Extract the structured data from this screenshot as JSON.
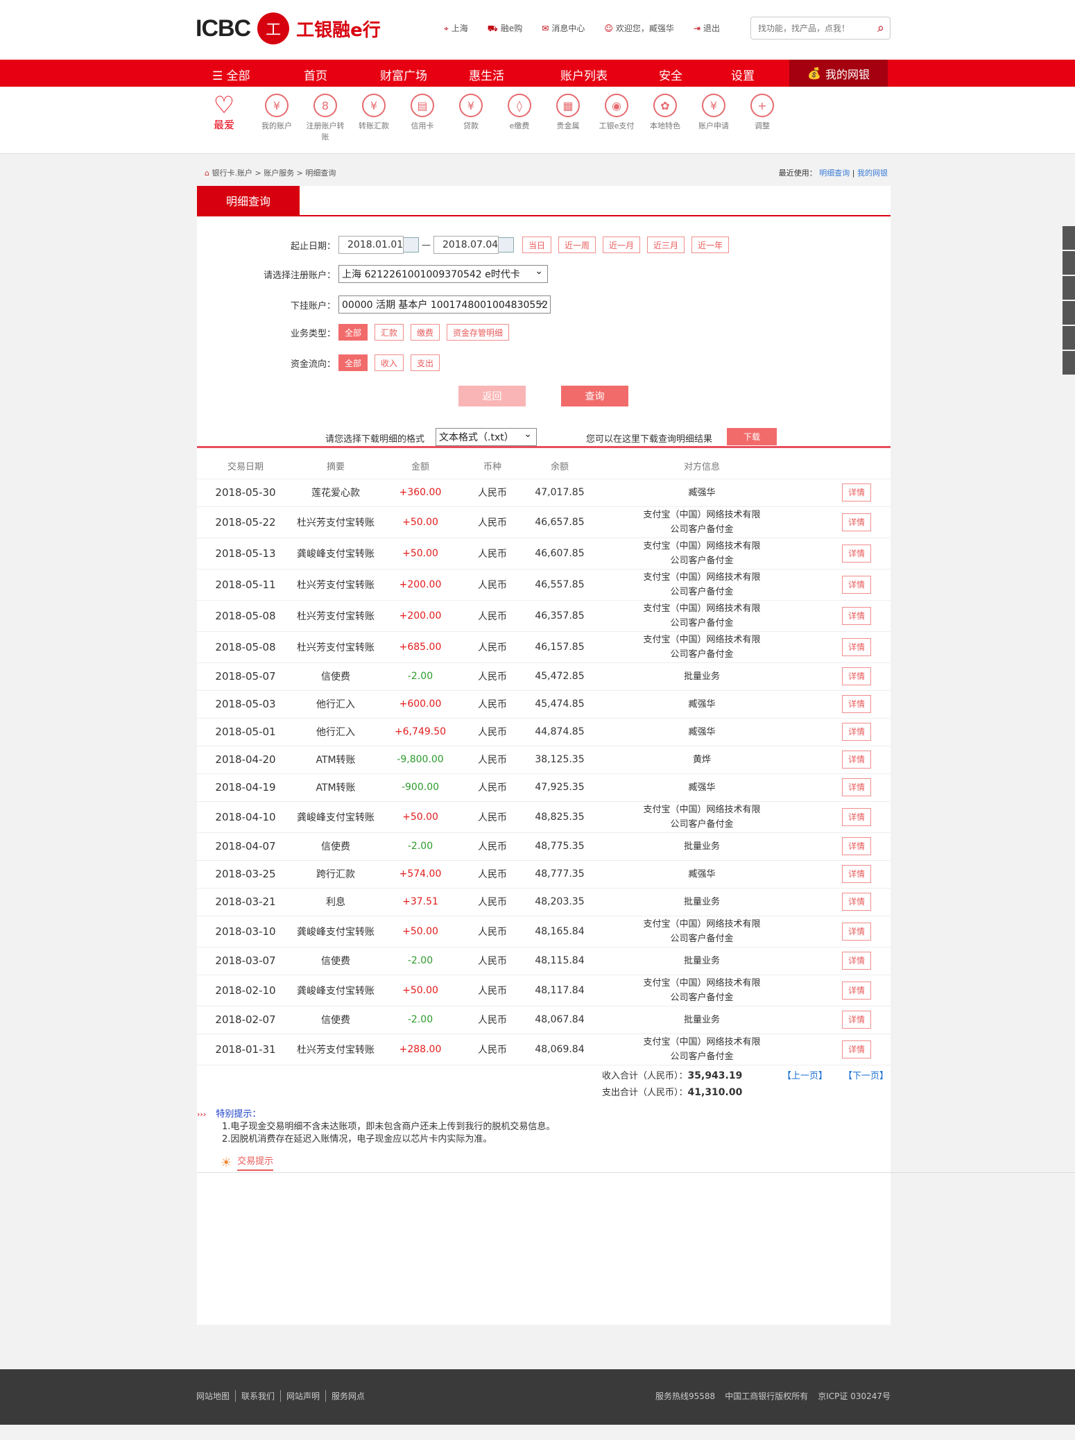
{
  "brand": {
    "icbc": "ICBC",
    "seal": "工",
    "name": "工银融e行"
  },
  "top_links": [
    {
      "icon": "location-icon",
      "glyph": "⌖",
      "label": "上海"
    },
    {
      "icon": "cart-icon",
      "glyph": "⛟",
      "label": "融e购"
    },
    {
      "icon": "mail-icon",
      "glyph": "✉",
      "label": "消息中心"
    },
    {
      "icon": "user-icon",
      "glyph": "☺",
      "label": "欢迎您，臧强华"
    },
    {
      "icon": "logout-icon",
      "glyph": "⇥",
      "label": "退出"
    }
  ],
  "search": {
    "placeholder": "找功能，找产品，点我！"
  },
  "nav": {
    "items": [
      "☰ 全部",
      "首页",
      "财富广场",
      "惠生活",
      "账户列表",
      "安全",
      "设置"
    ],
    "my_bank": "我的网银"
  },
  "quick": {
    "favorite": "最爱",
    "items": [
      {
        "label": "我的账户",
        "glyph": "¥",
        "icon": "account-icon"
      },
      {
        "label": "注册账户转账",
        "glyph": "8",
        "icon": "transfer-register-icon"
      },
      {
        "label": "转账汇款",
        "glyph": "¥",
        "icon": "remit-icon"
      },
      {
        "label": "信用卡",
        "glyph": "▤",
        "icon": "credit-card-icon"
      },
      {
        "label": "贷款",
        "glyph": "¥",
        "icon": "loan-icon"
      },
      {
        "label": "e缴费",
        "glyph": "◊",
        "icon": "payment-icon"
      },
      {
        "label": "贵金属",
        "glyph": "▦",
        "icon": "gold-icon"
      },
      {
        "label": "工银e支付",
        "glyph": "◉",
        "icon": "epay-icon"
      },
      {
        "label": "本地特色",
        "glyph": "✿",
        "icon": "local-icon"
      },
      {
        "label": "账户申请",
        "glyph": "¥",
        "icon": "apply-icon"
      },
      {
        "label": "调整",
        "glyph": "+",
        "icon": "adjust-icon"
      }
    ]
  },
  "breadcrumb": {
    "path": "银行卡.账户 > 账户服务 > 明细查询"
  },
  "recent": {
    "label": "最近使用：",
    "a": "明细查询",
    "sep": "|",
    "b": "我的网银"
  },
  "tab": "明细查询",
  "form": {
    "date_label": "起止日期：",
    "start": "2018.01.01",
    "dash": "—",
    "end": "2018.07.04",
    "periods": [
      "当日",
      "近一周",
      "近一月",
      "近三月",
      "近一年"
    ],
    "account_label": "请选择注册账户：",
    "account_value": "上海 6212261001009370542 e时代卡",
    "sub_label": "下挂账户：",
    "sub_value": "00000 活期 基本户 1001748001004830552",
    "type_label": "业务类型：",
    "types": [
      "全部",
      "汇款",
      "缴费",
      "资金存管明细"
    ],
    "flow_label": "资金流向：",
    "flows": [
      "全部",
      "收入",
      "支出"
    ],
    "back": "返回",
    "query": "查询",
    "download_label": "请您选择下载明细的格式",
    "download_format": "文本格式（.txt）",
    "download_hint": "您可以在这里下载查询明细结果",
    "download_btn": "下载"
  },
  "table": {
    "headers": [
      "交易日期",
      "摘要",
      "金额",
      "币种",
      "余额",
      "对方信息",
      ""
    ],
    "detail_label": "详情",
    "rows": [
      {
        "date": "2018-05-30",
        "summary": "莲花爱心款",
        "amount": "+360.00",
        "sign": "pos",
        "cur": "人民币",
        "balance": "47,017.85",
        "cp": "臧强华"
      },
      {
        "date": "2018-05-22",
        "summary": "杜兴芳支付宝转账",
        "amount": "+50.00",
        "sign": "pos",
        "cur": "人民币",
        "balance": "46,657.85",
        "cp": "支付宝（中国）网络技术有限公司客户备付金"
      },
      {
        "date": "2018-05-13",
        "summary": "龚峻峰支付宝转账",
        "amount": "+50.00",
        "sign": "pos",
        "cur": "人民币",
        "balance": "46,607.85",
        "cp": "支付宝（中国）网络技术有限公司客户备付金"
      },
      {
        "date": "2018-05-11",
        "summary": "杜兴芳支付宝转账",
        "amount": "+200.00",
        "sign": "pos",
        "cur": "人民币",
        "balance": "46,557.85",
        "cp": "支付宝（中国）网络技术有限公司客户备付金"
      },
      {
        "date": "2018-05-08",
        "summary": "杜兴芳支付宝转账",
        "amount": "+200.00",
        "sign": "pos",
        "cur": "人民币",
        "balance": "46,357.85",
        "cp": "支付宝（中国）网络技术有限公司客户备付金"
      },
      {
        "date": "2018-05-08",
        "summary": "杜兴芳支付宝转账",
        "amount": "+685.00",
        "sign": "pos",
        "cur": "人民币",
        "balance": "46,157.85",
        "cp": "支付宝（中国）网络技术有限公司客户备付金"
      },
      {
        "date": "2018-05-07",
        "summary": "信使费",
        "amount": "-2.00",
        "sign": "neg",
        "cur": "人民币",
        "balance": "45,472.85",
        "cp": "批量业务"
      },
      {
        "date": "2018-05-03",
        "summary": "他行汇入",
        "amount": "+600.00",
        "sign": "pos",
        "cur": "人民币",
        "balance": "45,474.85",
        "cp": "臧强华"
      },
      {
        "date": "2018-05-01",
        "summary": "他行汇入",
        "amount": "+6,749.50",
        "sign": "pos",
        "cur": "人民币",
        "balance": "44,874.85",
        "cp": "臧强华"
      },
      {
        "date": "2018-04-20",
        "summary": "ATM转账",
        "amount": "-9,800.00",
        "sign": "neg",
        "cur": "人民币",
        "balance": "38,125.35",
        "cp": "黄烨"
      },
      {
        "date": "2018-04-19",
        "summary": "ATM转账",
        "amount": "-900.00",
        "sign": "neg",
        "cur": "人民币",
        "balance": "47,925.35",
        "cp": "臧强华"
      },
      {
        "date": "2018-04-10",
        "summary": "龚峻峰支付宝转账",
        "amount": "+50.00",
        "sign": "pos",
        "cur": "人民币",
        "balance": "48,825.35",
        "cp": "支付宝（中国）网络技术有限公司客户备付金"
      },
      {
        "date": "2018-04-07",
        "summary": "信使费",
        "amount": "-2.00",
        "sign": "neg",
        "cur": "人民币",
        "balance": "48,775.35",
        "cp": "批量业务"
      },
      {
        "date": "2018-03-25",
        "summary": "跨行汇款",
        "amount": "+574.00",
        "sign": "pos",
        "cur": "人民币",
        "balance": "48,777.35",
        "cp": "臧强华"
      },
      {
        "date": "2018-03-21",
        "summary": "利息",
        "amount": "+37.51",
        "sign": "pos",
        "cur": "人民币",
        "balance": "48,203.35",
        "cp": "批量业务"
      },
      {
        "date": "2018-03-10",
        "summary": "龚峻峰支付宝转账",
        "amount": "+50.00",
        "sign": "pos",
        "cur": "人民币",
        "balance": "48,165.84",
        "cp": "支付宝（中国）网络技术有限公司客户备付金"
      },
      {
        "date": "2018-03-07",
        "summary": "信使费",
        "amount": "-2.00",
        "sign": "neg",
        "cur": "人民币",
        "balance": "48,115.84",
        "cp": "批量业务"
      },
      {
        "date": "2018-02-10",
        "summary": "龚峻峰支付宝转账",
        "amount": "+50.00",
        "sign": "pos",
        "cur": "人民币",
        "balance": "48,117.84",
        "cp": "支付宝（中国）网络技术有限公司客户备付金"
      },
      {
        "date": "2018-02-07",
        "summary": "信使费",
        "amount": "-2.00",
        "sign": "neg",
        "cur": "人民币",
        "balance": "48,067.84",
        "cp": "批量业务"
      },
      {
        "date": "2018-01-31",
        "summary": "杜兴芳支付宝转账",
        "amount": "+288.00",
        "sign": "pos",
        "cur": "人民币",
        "balance": "48,069.84",
        "cp": "支付宝（中国）网络技术有限公司客户备付金"
      }
    ]
  },
  "totals": {
    "income_label": "收入合计（人民币）：",
    "income": "35,943.19",
    "expense_label": "支出合计（人民币）：",
    "expense": "41,310.00",
    "prev": "【上一页】",
    "next": "【下一页】"
  },
  "notice": {
    "title": "特别提示：",
    "line1": "1.电子现金交易明细不含未达账项，即未包含商户还未上传到我行的脱机交易信息。",
    "line2": "2.因脱机消费存在延迟入账情况，电子现金应以芯片卡内实际为准。",
    "tips": "交易提示"
  },
  "footer": {
    "links": [
      "网站地图",
      "联系我们",
      "网站声明",
      "服务网点"
    ],
    "hotline": "服务热线95588",
    "copyright": "中国工商银行版权所有",
    "icp": "京ICP证 030247号"
  },
  "colors": {
    "brand_red": "#e60012",
    "dark_red": "#a40010",
    "pos": "#e21b1b",
    "neg": "#2c9a2c"
  }
}
